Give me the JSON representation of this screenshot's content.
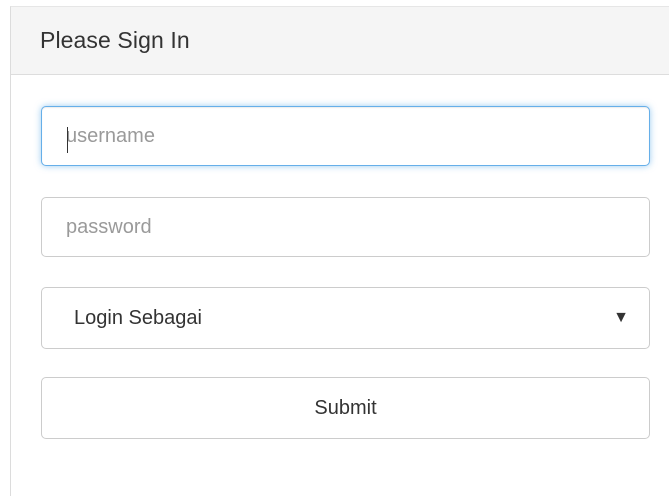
{
  "panel": {
    "title": "Please Sign In"
  },
  "form": {
    "username_placeholder": "username",
    "username_value": "",
    "password_placeholder": "password",
    "password_value": "",
    "login_as": {
      "selected": "Login Sebagai"
    },
    "submit_label": "Submit"
  },
  "colors": {
    "focus_border": "#66afe9",
    "heading_bg": "#f5f5f5"
  },
  "icons": {
    "select_arrow": "triangle-down-icon"
  }
}
